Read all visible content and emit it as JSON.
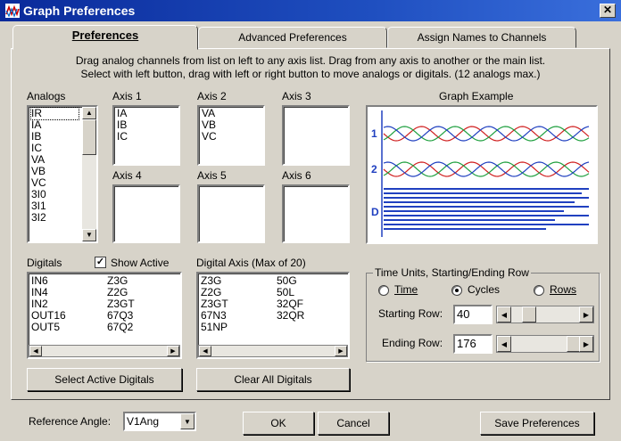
{
  "window": {
    "title": "Graph Preferences",
    "close_glyph": "✕"
  },
  "tabs": [
    {
      "label": "Preferences",
      "active": true
    },
    {
      "label": "Advanced Preferences",
      "active": false
    },
    {
      "label": "Assign Names to Channels",
      "active": false
    }
  ],
  "instructions": {
    "line1": "Drag analog channels from list on left to any axis list. Drag from any axis to another or the main list.",
    "line2": "Select with left button, drag with left or right button to move analogs or digitals. (12 analogs max.)"
  },
  "analogs": {
    "label": "Analogs",
    "items": [
      "IR",
      "IA",
      "IB",
      "IC",
      "VA",
      "VB",
      "VC",
      "3I0",
      "3I1",
      "3I2"
    ]
  },
  "axes": [
    {
      "label": "Axis 1",
      "items": [
        "IA",
        "IB",
        "IC"
      ]
    },
    {
      "label": "Axis 2",
      "items": [
        "VA",
        "VB",
        "VC"
      ]
    },
    {
      "label": "Axis 3",
      "items": []
    },
    {
      "label": "Axis 4",
      "items": []
    },
    {
      "label": "Axis 5",
      "items": []
    },
    {
      "label": "Axis 6",
      "items": []
    }
  ],
  "graph_example": {
    "label": "Graph Example",
    "axis_labels": [
      "1",
      "2",
      "D"
    ]
  },
  "digitals": {
    "label": "Digitals",
    "show_active_label": "Show Active",
    "show_active_checked": true,
    "col1": [
      "IN6",
      "IN4",
      "IN2",
      "OUT16",
      "OUT5"
    ],
    "col2": [
      "Z3G",
      "Z2G",
      "Z3GT",
      "67Q3",
      "67Q2"
    ]
  },
  "digital_axis": {
    "label": "Digital Axis (Max of 20)",
    "col1": [
      "Z3G",
      "Z2G",
      "Z3GT",
      "67N3",
      "51NP"
    ],
    "col2": [
      "50G",
      "50L",
      "32QF",
      "32QR"
    ]
  },
  "time_units": {
    "group_label": "Time Units, Starting/Ending Row",
    "options": [
      {
        "label": "Time",
        "selected": false
      },
      {
        "label": "Cycles",
        "selected": true
      },
      {
        "label": "Rows",
        "selected": false
      }
    ],
    "starting_row_label": "Starting Row:",
    "starting_row_value": "40",
    "ending_row_label": "Ending Row:",
    "ending_row_value": "176"
  },
  "buttons": {
    "select_active_digitals": "Select Active Digitals",
    "clear_all_digitals": "Clear All Digitals",
    "ok": "OK",
    "cancel": "Cancel",
    "save_preferences": "Save Preferences"
  },
  "reference_angle": {
    "label": "Reference Angle:",
    "value": "V1Ang"
  },
  "colors": {
    "title_bar": "#0a2a9a",
    "wave_red": "#d02020",
    "wave_green": "#20a040",
    "wave_blue": "#2040c0"
  }
}
